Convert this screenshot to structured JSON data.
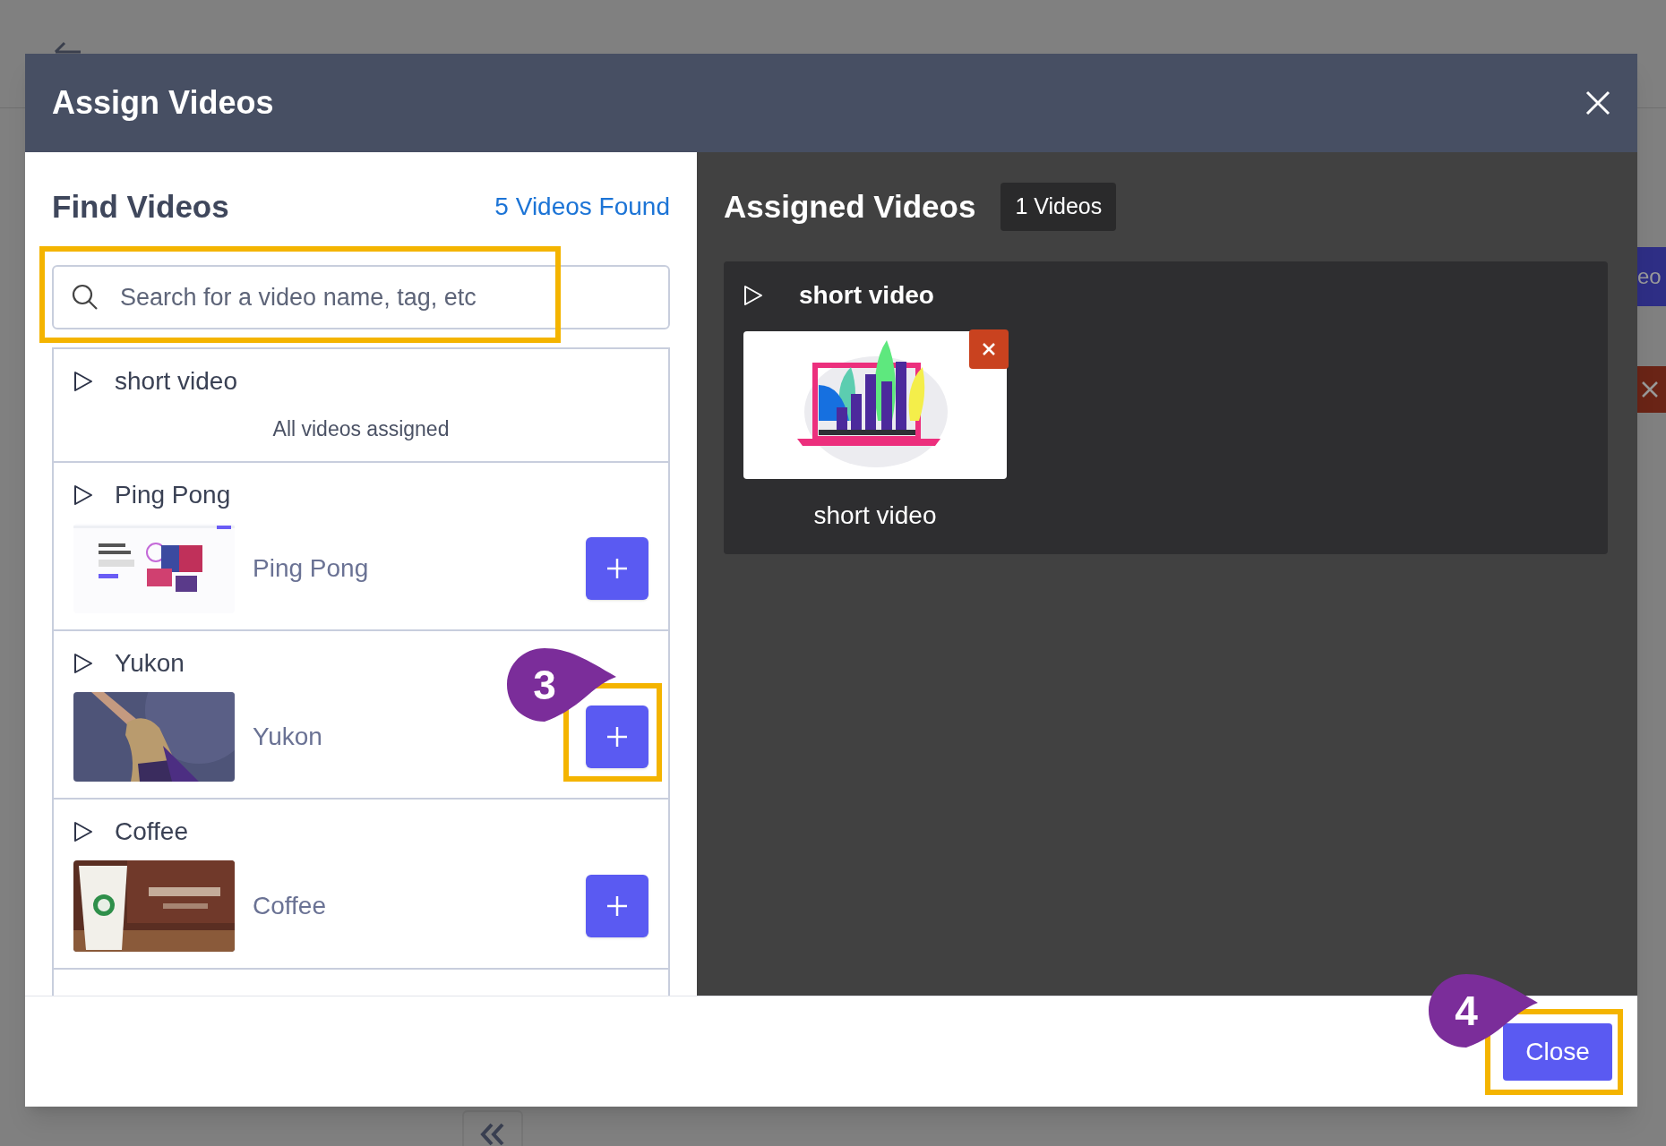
{
  "background": {
    "side_button": "eo"
  },
  "modal": {
    "title": "Assign Videos"
  },
  "find": {
    "title": "Find Videos",
    "count": "5 Videos Found",
    "search": {
      "placeholder": "Search for a video name, tag, etc"
    },
    "items": [
      {
        "kind": "assigned",
        "title": "short video",
        "note": "All videos assigned"
      },
      {
        "kind": "video",
        "title": "Ping Pong",
        "name": "Ping Pong"
      },
      {
        "kind": "video",
        "title": "Yukon",
        "name": "Yukon"
      },
      {
        "kind": "video",
        "title": "Coffee",
        "name": "Coffee"
      }
    ]
  },
  "assigned": {
    "title": "Assigned Videos",
    "badge": "1 Videos",
    "items": [
      {
        "title": "short video",
        "caption": "short video"
      }
    ]
  },
  "footer": {
    "close": "Close"
  },
  "annotations": [
    {
      "label": "3"
    },
    {
      "label": "4"
    }
  ]
}
